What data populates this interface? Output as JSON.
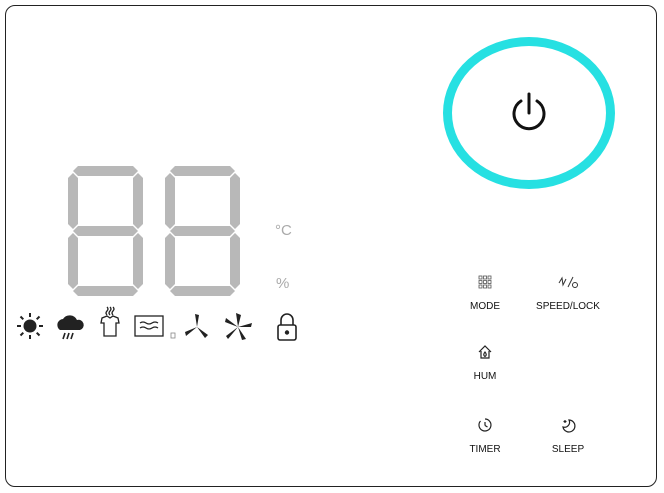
{
  "display": {
    "digits": "88",
    "unit_celsius": "°C",
    "unit_percent": "%"
  },
  "status_icons": [
    "sun-icon",
    "rain-cloud-icon",
    "laundry-dry-icon",
    "heater-icon",
    "fan-low-icon",
    "fan-high-icon",
    "lock-icon"
  ],
  "power": {
    "icon": "power-icon"
  },
  "buttons": {
    "mode": {
      "label": "MODE",
      "icon": "mode-grid-icon"
    },
    "speed_lock": {
      "label": "SPEED/LOCK",
      "icon": "speed-lock-icon"
    },
    "hum": {
      "label": "HUM",
      "icon": "home-humidity-icon"
    },
    "timer": {
      "label": "TIMER",
      "icon": "timer-icon"
    },
    "sleep": {
      "label": "SLEEP",
      "icon": "sleep-moon-icon"
    }
  },
  "colors": {
    "accent": "#26e0e2",
    "segment": "#b8b8b8",
    "border": "#222222"
  }
}
